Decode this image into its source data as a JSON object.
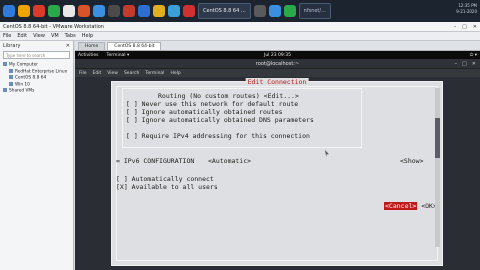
{
  "host_taskbar": {
    "tasks": [
      "CentOS 8.8 64 ...",
      "nfsnet/..."
    ],
    "clock": [
      "12:35 PM",
      "9-21-2020"
    ],
    "colors": [
      "#2f7bd9",
      "#f0a400",
      "#d93a2b",
      "#2aa84a",
      "#e8e8e8",
      "#d9542b",
      "#3a8fe0",
      "#4a4a4a",
      "#c23b2b",
      "#2c6fd1",
      "#e0b020",
      "#3aa0d8",
      "#d03030",
      "#5a5a5a"
    ]
  },
  "vmware": {
    "title": "CentOS 8.8 64-bit - VMware Workstation",
    "menu": [
      "File",
      "Edit",
      "View",
      "VM",
      "Tabs",
      "Help"
    ],
    "library": {
      "header": "Library",
      "search_placeholder": "Type here to search",
      "tree": [
        {
          "label": "My Computer",
          "level": 1
        },
        {
          "label": "RedHat Enterprise Linux",
          "level": 2
        },
        {
          "label": "CentOS 8.8 64",
          "level": 2
        },
        {
          "label": "Win 10",
          "level": 2
        },
        {
          "label": "Shared VMs",
          "level": 1
        }
      ]
    },
    "tabs": [
      "Home",
      "CentOS 8.8 64-bit"
    ]
  },
  "gnome": {
    "activities": "Activities",
    "app": "Terminal ▾",
    "clock": "Jul 23 09:35"
  },
  "terminal": {
    "title": "root@localhost:~",
    "menu": [
      "File",
      "Edit",
      "View",
      "Search",
      "Terminal",
      "Help"
    ]
  },
  "dialog": {
    "title": "Edit Connection",
    "routing": "Routing (No custom routes) <Edit...>",
    "checks": [
      "[ ] Never use this network for default route",
      "[ ] Ignore automatically obtained routes",
      "[ ] Ignore automatically obtained DNS parameters"
    ],
    "require_ipv4": "[ ] Require IPv4 addressing for this connection",
    "ipv6_label": "= IPv6 CONFIGURATION",
    "ipv6_value": "<Automatic>",
    "ipv6_show": "<Show>",
    "auto_connect": "[ ] Automatically connect",
    "available": "[X] Available to all users",
    "cancel": "<Cancel>",
    "ok": "<OK>"
  }
}
